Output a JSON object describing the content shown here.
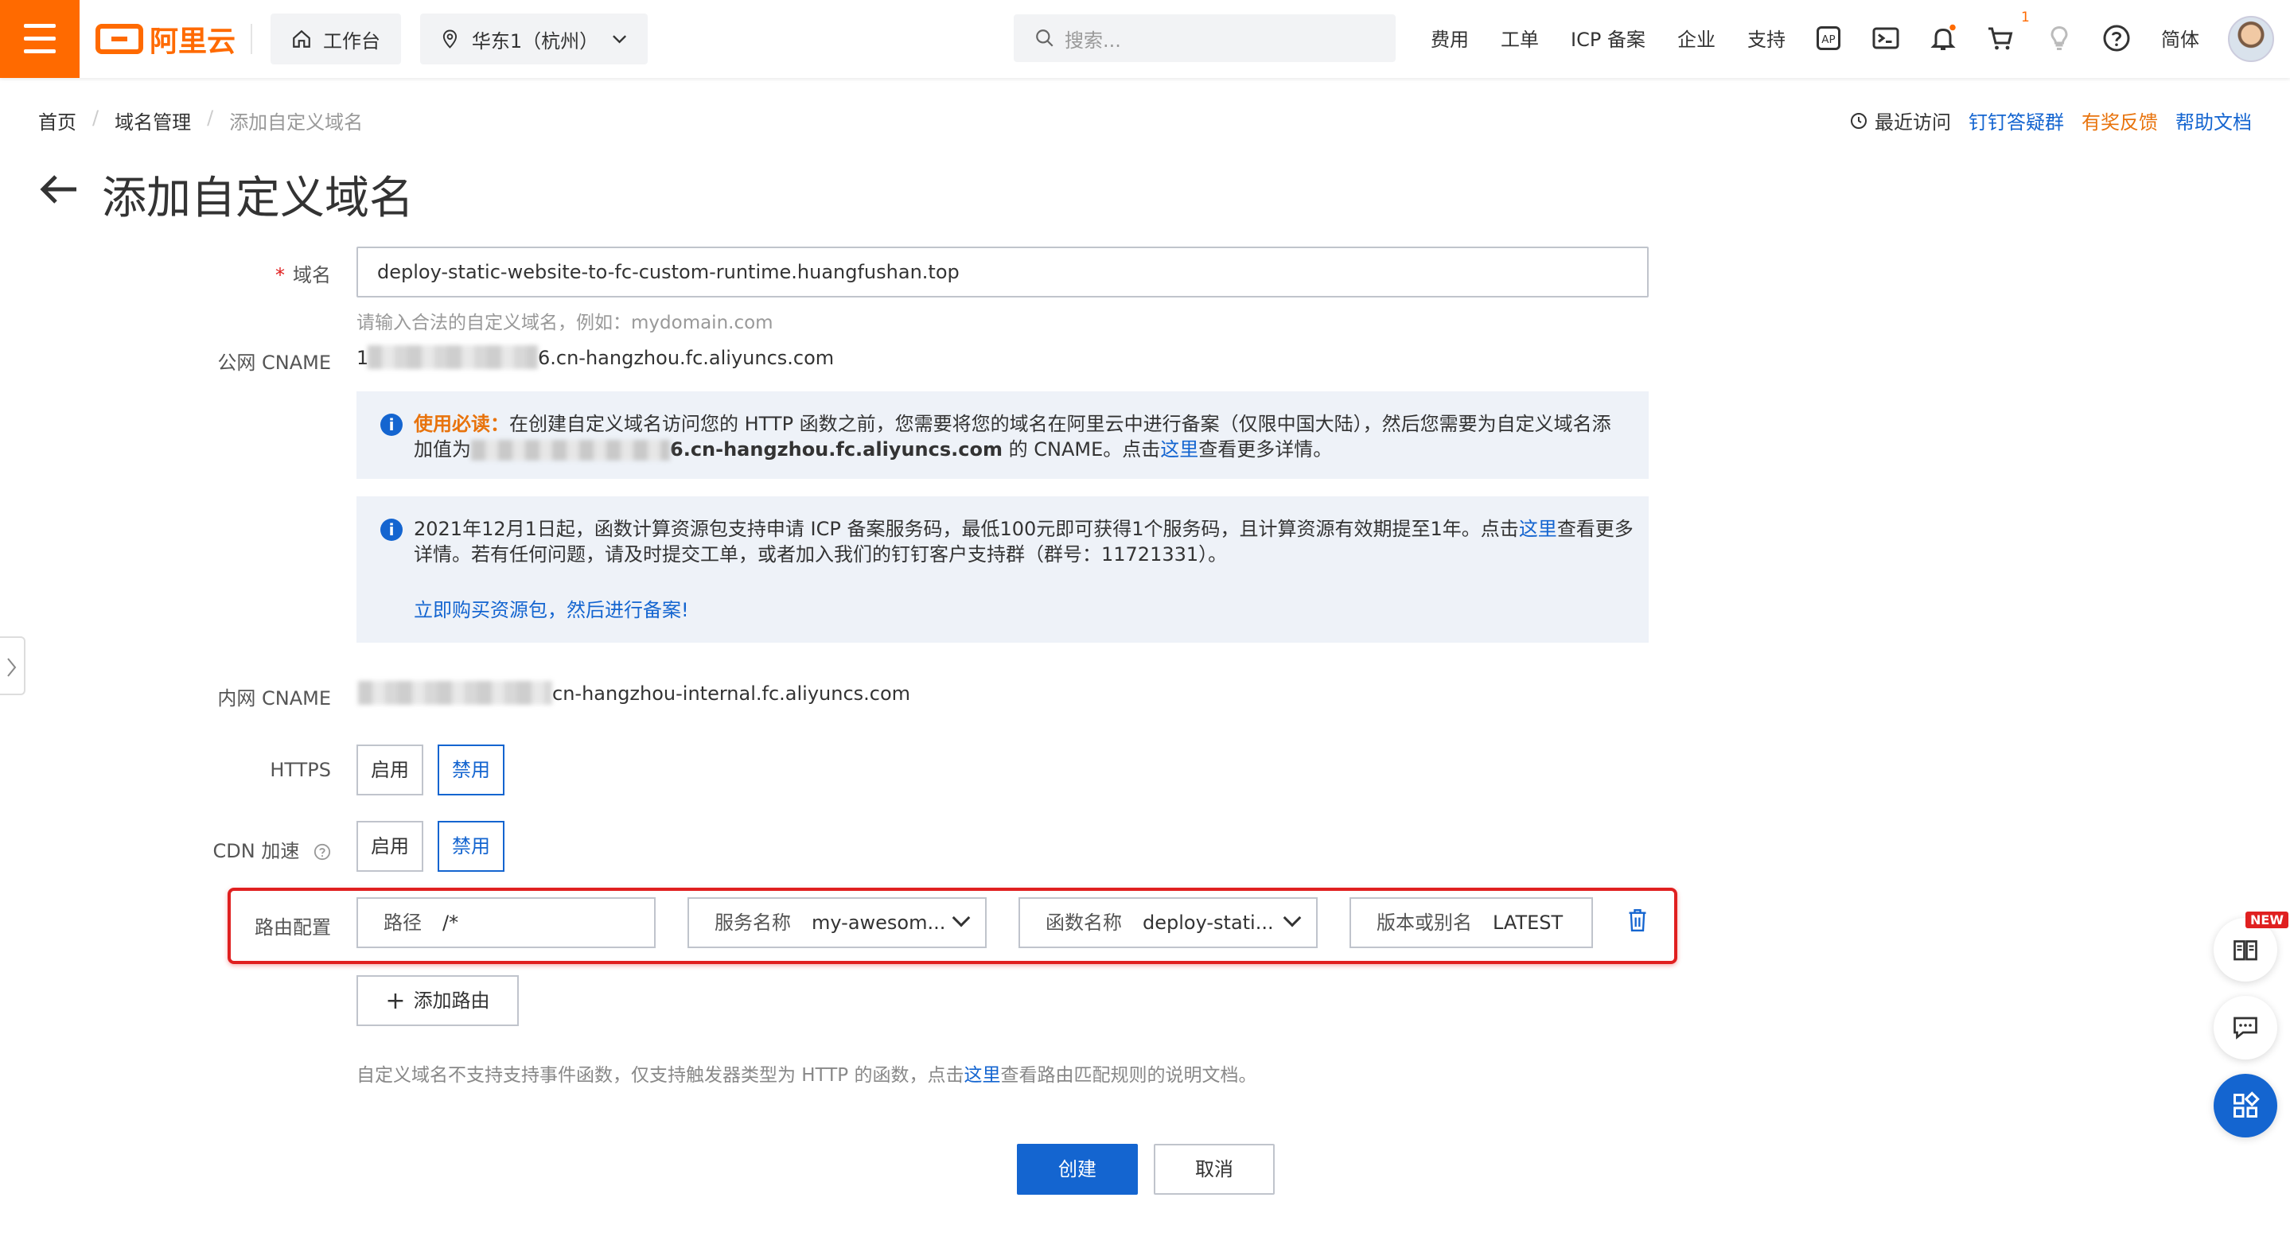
{
  "header": {
    "logo_text": "阿里云",
    "workbench_label": "工作台",
    "region_label": "华东1（杭州）",
    "search_placeholder": "搜索...",
    "nav": [
      "费用",
      "工单",
      "ICP 备案",
      "企业",
      "支持"
    ],
    "cart_count": "1",
    "language_label": "简体"
  },
  "breadcrumb": [
    "首页",
    "域名管理",
    "添加自定义域名"
  ],
  "top_links": {
    "recent": "最近访问",
    "dingtalk": "钉钉答疑群",
    "feedback": "有奖反馈",
    "help": "帮助文档"
  },
  "page_title": "添加自定义域名",
  "form": {
    "domain_label": "域名",
    "domain_value": "deploy-static-website-to-fc-custom-runtime.huangfushan.top",
    "domain_hint": "请输入合法的自定义域名，例如：mydomain.com",
    "public_cname_label": "公网 CNAME",
    "public_cname_prefix": "1",
    "public_cname_suffix": "6.cn-hangzhou.fc.aliyuncs.com",
    "notice1_prefix": "使用必读：",
    "notice1_text": "在创建自定义域名访问您的 HTTP 函数之前，您需要将您的域名在阿里云中进行备案（仅限中国大陆），然后您需要为自定义域名添",
    "notice1_line2_a": "加值为",
    "notice1_line2_bold": "6.cn-hangzhou.fc.aliyuncs.com",
    "notice1_line2_b": " 的 CNAME。点击",
    "notice1_link": "这里",
    "notice1_line2_c": "查看更多详情。",
    "notice2_line1_a": "2021年12月1日起，函数计算资源包支持申请 ICP 备案服务码，最低100元即可获得1个服务码，且计算资源有效期提至1年。点击",
    "notice2_link": "这里",
    "notice2_line1_b": "查看更多",
    "notice2_line2": "详情。若有任何问题，请及时提交工单，或者加入我们的钉钉客户支持群（群号：11721331）。",
    "notice2_action": "立即购买资源包，然后进行备案!",
    "internal_cname_label": "内网 CNAME",
    "internal_cname_suffix": "cn-hangzhou-internal.fc.aliyuncs.com",
    "https_label": "HTTPS",
    "cdn_label": "CDN 加速",
    "enable_label": "启用",
    "disable_label": "禁用",
    "route_label": "路由配置",
    "route": {
      "path_key": "路径",
      "path_value": "/*",
      "service_key": "服务名称",
      "service_value": "my-awesom...",
      "function_key": "函数名称",
      "function_value": "deploy-stati...",
      "version_key": "版本或别名",
      "version_value": "LATEST"
    },
    "add_route_label": "添加路由",
    "footer_note_a": "自定义域名不支持支持事件函数，仅支持触发器类型为 HTTP 的函数，点击",
    "footer_note_link": "这里",
    "footer_note_b": "查看路由匹配规则的说明文档。",
    "create_label": "创建",
    "cancel_label": "取消"
  },
  "floating": {
    "new_badge": "NEW"
  },
  "colors": {
    "brand": "#ff6a00",
    "primary": "#1465d0",
    "highlight": "#e02020"
  }
}
